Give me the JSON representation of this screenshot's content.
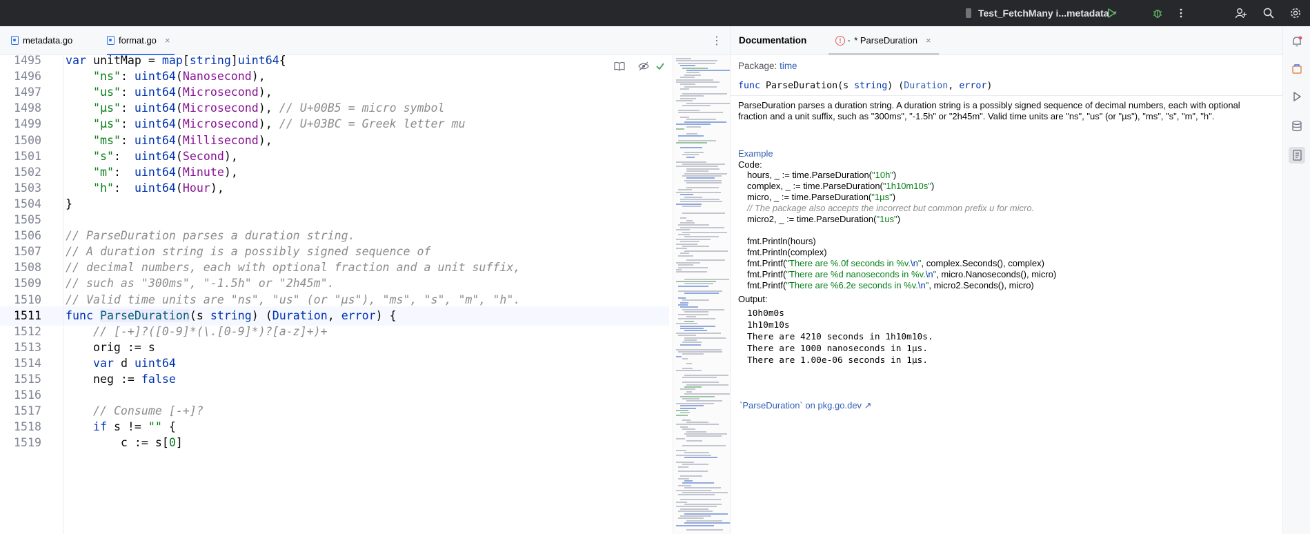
{
  "topbar": {
    "run_config": "Test_FetchMany i...metadata",
    "icons": [
      "run-icon",
      "debug-icon",
      "more-icon",
      "add-user-icon",
      "search-icon",
      "settings-icon"
    ]
  },
  "editor_tabs": [
    {
      "label": "metadata.go",
      "active": false
    },
    {
      "label": "format.go",
      "active": true,
      "close": "×"
    }
  ],
  "tabs_more": "⋮",
  "editor": {
    "current_line": 1511,
    "lines": [
      {
        "n": "1495",
        "html": "<span class=\"kw\">var</span> unitMap = <span class=\"kw\">map</span>[<span class=\"tp\">string</span>]<span class=\"tp\">uint64</span>{"
      },
      {
        "n": "1496",
        "html": "    <span class=\"str\">\"ns\"</span>: <span class=\"tp\">uint64</span>(<span class=\"cst\">Nanosecond</span>),"
      },
      {
        "n": "1497",
        "html": "    <span class=\"str\">\"us\"</span>: <span class=\"tp\">uint64</span>(<span class=\"cst\">Microsecond</span>),"
      },
      {
        "n": "1498",
        "html": "    <span class=\"str\">\"µs\"</span>: <span class=\"tp\">uint64</span>(<span class=\"cst\">Microsecond</span>), <span class=\"cmt\">// U+00B5 = micro symbol</span>"
      },
      {
        "n": "1499",
        "html": "    <span class=\"str\">\"μs\"</span>: <span class=\"tp\">uint64</span>(<span class=\"cst\">Microsecond</span>), <span class=\"cmt\">// U+03BC = Greek letter mu</span>"
      },
      {
        "n": "1500",
        "html": "    <span class=\"str\">\"ms\"</span>: <span class=\"tp\">uint64</span>(<span class=\"cst\">Millisecond</span>),"
      },
      {
        "n": "1501",
        "html": "    <span class=\"str\">\"s\"</span>:  <span class=\"tp\">uint64</span>(<span class=\"cst\">Second</span>),"
      },
      {
        "n": "1502",
        "html": "    <span class=\"str\">\"m\"</span>:  <span class=\"tp\">uint64</span>(<span class=\"cst\">Minute</span>),"
      },
      {
        "n": "1503",
        "html": "    <span class=\"str\">\"h\"</span>:  <span class=\"tp\">uint64</span>(<span class=\"cst\">Hour</span>),"
      },
      {
        "n": "1504",
        "html": "}"
      },
      {
        "n": "1505",
        "html": ""
      },
      {
        "n": "1506",
        "html": "<span class=\"cmt\">// ParseDuration parses a duration string.</span>"
      },
      {
        "n": "1507",
        "html": "<span class=\"cmt\">// A duration string is a possibly signed sequence of</span>"
      },
      {
        "n": "1508",
        "html": "<span class=\"cmt\">// decimal numbers, each with optional fraction and a unit suffix,</span>"
      },
      {
        "n": "1509",
        "html": "<span class=\"cmt\">// such as \"300ms\", \"-1.5h\" or \"2h45m\".</span>"
      },
      {
        "n": "1510",
        "html": "<span class=\"cmt\">// Valid time units are \"ns\", \"us\" (or \"µs\"), \"ms\", \"s\", \"m\", \"h\".</span>"
      },
      {
        "n": "1511",
        "html": "<span class=\"kw\">func</span> <span class=\"fn hl-decl\">ParseDuration</span>(s <span class=\"tp\">string</span>) (<span class=\"tp\">Duration</span>, <span class=\"tp\">error</span>) {"
      },
      {
        "n": "1512",
        "html": "    <span class=\"cmt\">// [-+]?([0-9]*(\\.[0-9]*)?[a-z]+)+</span>"
      },
      {
        "n": "1513",
        "html": "    orig := s"
      },
      {
        "n": "1514",
        "html": "    <span class=\"kw\">var</span> d <span class=\"tp\">uint64</span>"
      },
      {
        "n": "1515",
        "html": "    neg := <span class=\"kw\">false</span>"
      },
      {
        "n": "1516",
        "html": ""
      },
      {
        "n": "1517",
        "html": "    <span class=\"cmt\">// Consume [-+]?</span>"
      },
      {
        "n": "1518",
        "html": "    <span class=\"kw\">if</span> s != <span class=\"str\">\"\"</span> {"
      },
      {
        "n": "1519",
        "html": "        c := s[<span class=\"str\">0</span>]"
      }
    ]
  },
  "docs": {
    "panel_title": "Documentation",
    "tab_label": "* ParseDuration",
    "err_badge": "!",
    "lock_badge": "🔒",
    "close": "×",
    "package_label": "Package:",
    "package_name": "time",
    "signature": {
      "kw": "func",
      "name": "ParseDuration",
      "param": "s",
      "param_type": "string",
      "ret1": "Duration",
      "ret2": "error"
    },
    "description": "ParseDuration parses a duration string. A duration string is a possibly signed sequence of decimal numbers, each with optional fraction and a unit suffix, such as \"300ms\", \"-1.5h\" or \"2h45m\". Valid time units are \"ns\", \"us\" (or \"µs\"), \"ms\", \"s\", \"m\", \"h\".",
    "example_label": "Example",
    "code_label": "Code:",
    "code_lines": [
      {
        "html": "hours, _ := time.ParseDuration(<span class=\"s\">\"10h\"</span>)"
      },
      {
        "html": "complex, _ := time.ParseDuration(<span class=\"s\">\"1h10m10s\"</span>)"
      },
      {
        "html": "micro, _ := time.ParseDuration(<span class=\"s\">\"1µs\"</span>)"
      },
      {
        "html": "<span class=\"c\">// The package also accepts the incorrect but common prefix u for micro.</span>"
      },
      {
        "html": "micro2, _ := time.ParseDuration(<span class=\"s\">\"1us\"</span>)"
      },
      {
        "html": ""
      },
      {
        "html": "fmt.Println(hours)"
      },
      {
        "html": "fmt.Println(complex)"
      },
      {
        "html": "fmt.Printf(<span class=\"s\">\"There are %.0f seconds in %v.<span class=\"esc\">\\n</span>\"</span>, complex.Seconds(), complex)"
      },
      {
        "html": "fmt.Printf(<span class=\"s\">\"There are %d nanoseconds in %v.<span class=\"esc\">\\n</span>\"</span>, micro.Nanoseconds(), micro)"
      },
      {
        "html": "fmt.Printf(<span class=\"s\">\"There are %6.2e seconds in %v.<span class=\"esc\">\\n</span>\"</span>, micro2.Seconds(), micro)"
      }
    ],
    "output_label": "Output:",
    "output_lines": [
      "10h0m0s",
      "1h10m10s",
      "There are 4210 seconds in 1h10m10s.",
      "There are 1000 nanoseconds in 1µs.",
      "There are 1.00e-06 seconds in 1µs."
    ],
    "ext_link": "`ParseDuration` on pkg.go.dev ↗"
  },
  "toolstrip": [
    "notifications-icon",
    "plugin-icon",
    "run-panel-icon",
    "database-icon",
    "documentation-icon"
  ]
}
